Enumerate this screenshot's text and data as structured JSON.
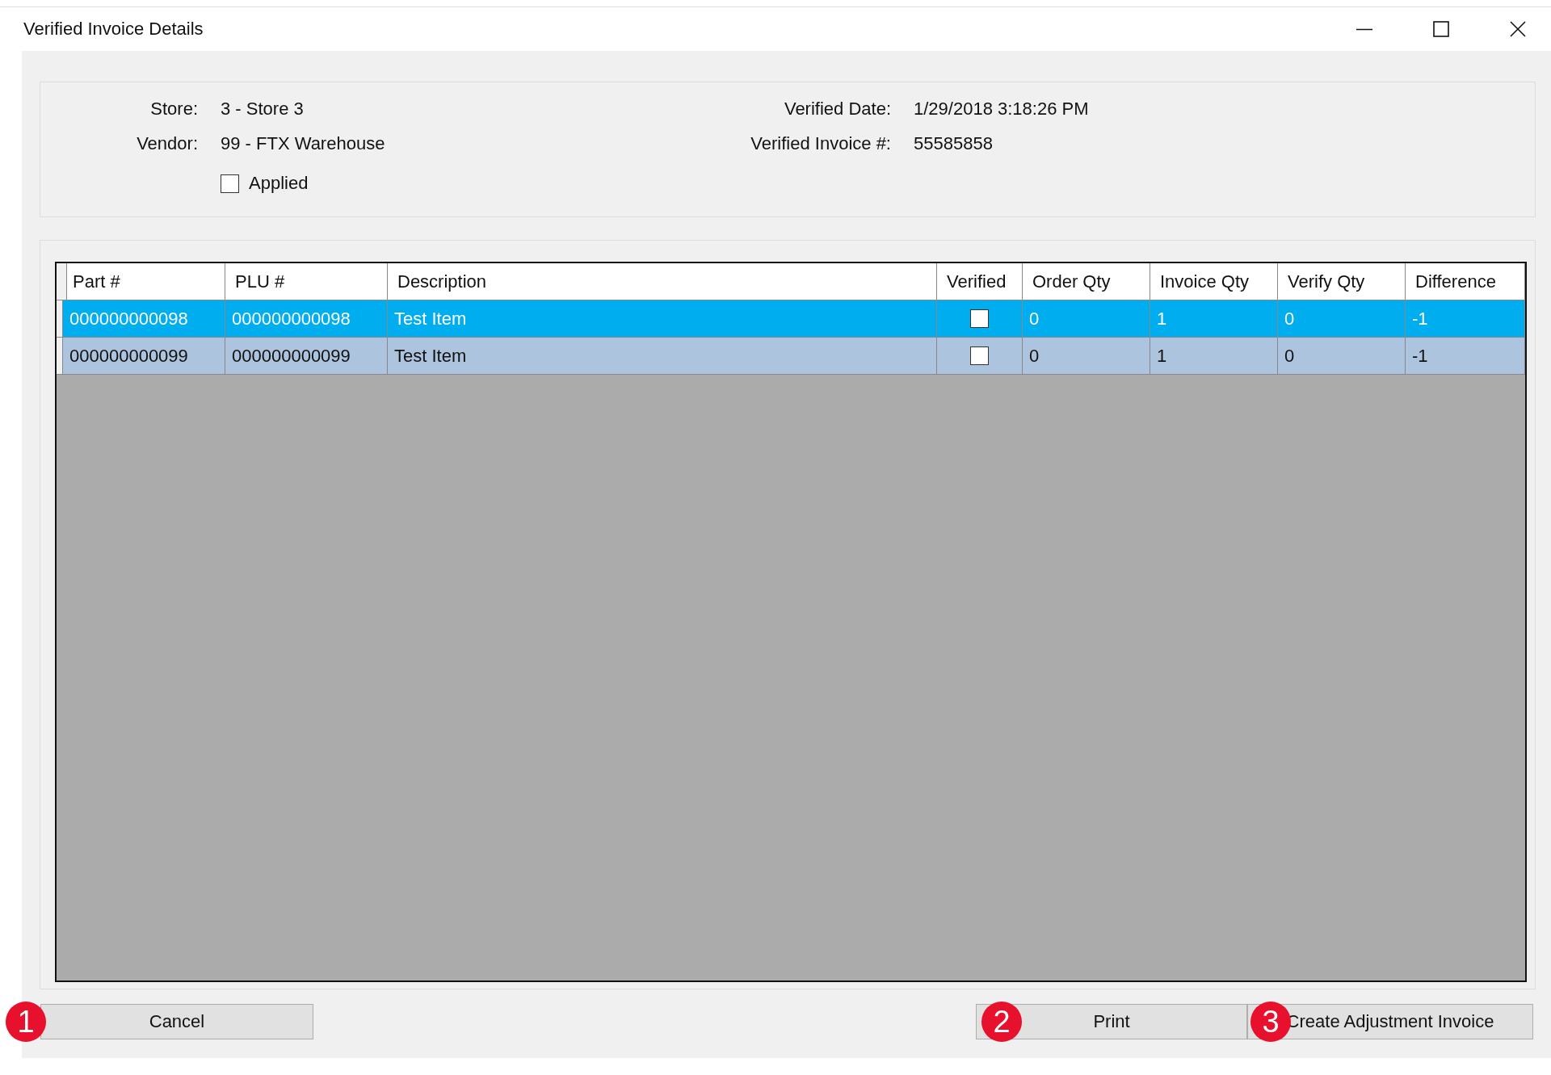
{
  "window": {
    "title": "Verified Invoice Details"
  },
  "header": {
    "fields": [
      {
        "label": "Store:",
        "value": "3 - Store 3"
      },
      {
        "label": "Vendor:",
        "value": "99 - FTX Warehouse"
      },
      {
        "label": "Verified Date:",
        "value": "1/29/2018 3:18:26 PM"
      },
      {
        "label": "Verified Invoice #:",
        "value": "55585858"
      }
    ],
    "applied": {
      "label": "Applied",
      "checked": false
    }
  },
  "table": {
    "columns": [
      "Part #",
      "PLU #",
      "Description",
      "Verified",
      "Order Qty",
      "Invoice Qty",
      "Verify Qty",
      "Difference"
    ],
    "rows": [
      {
        "selected": true,
        "cells": [
          "000000000098",
          "000000000098",
          "Test Item",
          "",
          "0",
          "1",
          "0",
          "-1"
        ],
        "verified": false
      },
      {
        "selected": false,
        "cells": [
          "000000000099",
          "000000000099",
          "Test Item",
          "",
          "0",
          "1",
          "0",
          "-1"
        ],
        "verified": false
      }
    ]
  },
  "buttons": [
    {
      "label": "Cancel",
      "callout": "1"
    },
    {
      "label": "Print",
      "callout": "2"
    },
    {
      "label": "Create Adjustment Invoice",
      "callout": "3"
    }
  ]
}
